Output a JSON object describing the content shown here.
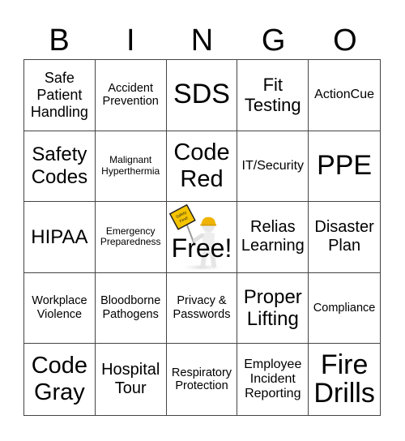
{
  "header": [
    "B",
    "I",
    "N",
    "G",
    "O"
  ],
  "cells": [
    "Safe Patient Handling",
    "Accident Prevention",
    "SDS",
    "Fit Testing",
    "ActionCue",
    "Safety Codes",
    "Malignant Hyperthermia",
    "Code Red",
    "IT/Security",
    "PPE",
    "HIPAA",
    "Emergency Preparedness",
    "Free!",
    "Relias Learning",
    "Disaster Plan",
    "Workplace Violence",
    "Bloodborne Pathogens",
    "Privacy & Passwords",
    "Proper Lifting",
    "Compliance",
    "Code Gray",
    "Hospital Tour",
    "Respiratory Protection",
    "Employee Incident Reporting",
    "Fire Drills"
  ],
  "free_space": {
    "label": "Free!",
    "icon": "safety-first-figure-icon",
    "sign_text": "Safety First!",
    "sign_color": "#f5c400",
    "helmet_color": "#f0b400"
  }
}
